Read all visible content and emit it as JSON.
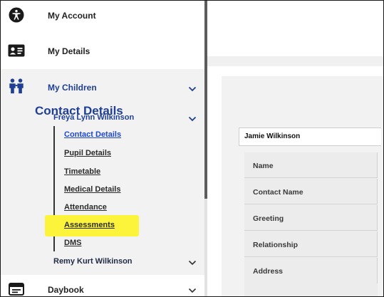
{
  "sidebar": {
    "items": [
      {
        "label": "My Account",
        "icon": "accessibility-icon"
      },
      {
        "label": "My Details",
        "icon": "id-card-icon"
      },
      {
        "label": "My Children",
        "icon": "children-icon"
      },
      {
        "label": "Daybook",
        "icon": "daybook-icon"
      }
    ],
    "children": [
      {
        "name": "Freya Lynn Wilkinson",
        "links": [
          "Contact Details",
          "Pupil Details",
          "Timetable",
          "Medical Details",
          "Attendance",
          "Assessments",
          "DMS"
        ]
      },
      {
        "name": "Remy Kurt Wilkinson"
      }
    ]
  },
  "main": {
    "section_title": "Contact Details",
    "contact_select": "Jamie Wilkinson",
    "table_rows": [
      "Name",
      "Contact Name",
      "Greeting",
      "Relationship",
      "Address"
    ]
  },
  "colors": {
    "accent": "#1f3f95",
    "link_active": "#1f48c9",
    "highlight": "#fbf43a"
  }
}
